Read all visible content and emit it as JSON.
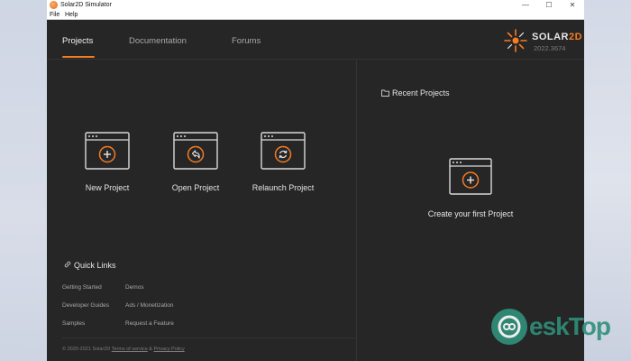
{
  "window": {
    "title": "Solar2D Simulator",
    "controls": {
      "minimize": "—",
      "maximize": "☐",
      "close": "✕"
    }
  },
  "menubar": {
    "items": [
      "File",
      "Help"
    ]
  },
  "nav": {
    "tabs": [
      {
        "label": "Projects",
        "active": true
      },
      {
        "label": "Documentation",
        "active": false
      },
      {
        "label": "Forums",
        "active": false
      }
    ]
  },
  "brand": {
    "name_part1": "SOLAR",
    "name_part2": "2D",
    "version": "2022.3674",
    "accent": "#f57c21"
  },
  "actions": [
    {
      "label": "New Project",
      "icon": "plus-icon"
    },
    {
      "label": "Open Project",
      "icon": "undo-arrow-icon"
    },
    {
      "label": "Relaunch Project",
      "icon": "refresh-icon"
    }
  ],
  "recent": {
    "title": "Recent Projects",
    "empty_label": "Create your first Project"
  },
  "quick_links": {
    "title": "Quick Links",
    "items": [
      "Getting Started",
      "Demos",
      "Developer Guides",
      "Ads / Monetization",
      "Samples",
      "Request a Feature"
    ]
  },
  "footer": {
    "prefix": "© 2020-2021 Solar2D",
    "terms": "Terms of service",
    "amp": "&",
    "privacy": "Privacy Policy"
  },
  "watermark": {
    "text": "eskTop"
  }
}
